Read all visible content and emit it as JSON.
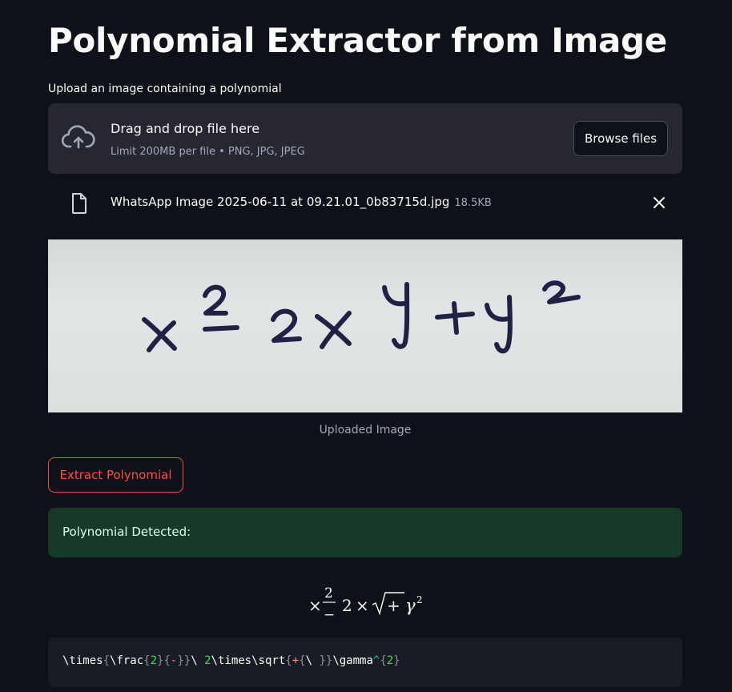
{
  "page": {
    "title": "Polynomial Extractor from Image"
  },
  "uploader": {
    "label": "Upload an image containing a polynomial",
    "dropzone_text": "Drag and drop file here",
    "limit_text": "Limit 200MB per file • PNG, JPG, JPEG",
    "browse_label": "Browse files",
    "icon": "cloud-upload-icon"
  },
  "uploaded_file": {
    "name": "WhatsApp Image 2025-06-11 at 09.21.01_0b83715d.jpg",
    "size": "18.5KB",
    "icon": "file-icon",
    "remove_icon": "close-icon"
  },
  "image": {
    "caption": "Uploaded Image"
  },
  "actions": {
    "extract_label": "Extract Polynomial"
  },
  "result": {
    "success_text": "Polynomial Detected:",
    "latex_code": "\\times{\\frac{2}{-}}\\ 2\\times\\sqrt{+{\\ }}\\gamma^{2}"
  },
  "colors": {
    "background": "#0e1117",
    "panel": "#262730",
    "accent": "#ff4b4b",
    "success_bg": "#173928",
    "success_text": "#dffde9",
    "code_bg": "#1a1c24"
  }
}
